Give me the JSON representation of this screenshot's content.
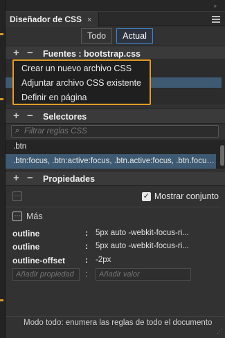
{
  "panel": {
    "title": "Diseñador de CSS",
    "close_glyph": "×"
  },
  "view_toggle": {
    "all_label": "Todo",
    "current_label": "Actual"
  },
  "sources": {
    "title": "Fuentes : bootstrap.css",
    "add_glyph": "+",
    "remove_glyph": "−"
  },
  "source_menu": {
    "items": [
      "Crear un nuevo archivo CSS",
      "Adjuntar archivo CSS existente",
      "Definir en página"
    ]
  },
  "selectors": {
    "title": "Selectores",
    "filter_placeholder": "Filtrar reglas CSS",
    "items": [
      ".btn",
      ".btn:focus, .btn:active:focus, .btn.active:focus, .btn.focus..."
    ],
    "selected_index": 1
  },
  "properties": {
    "title": "Propiedades",
    "show_set_label": "Mostrar conjunto",
    "show_set_checked": true,
    "more_label": "Más",
    "rows": [
      {
        "name": "outline",
        "value": "5px auto -webkit-focus-ri..."
      },
      {
        "name": "outline",
        "value": "5px auto -webkit-focus-ri..."
      },
      {
        "name": "outline-offset",
        "value": "-2px"
      }
    ],
    "add_property_placeholder": "Añadir propiedad",
    "add_value_placeholder": "Añadir valor"
  },
  "footer": {
    "text": "Modo todo: enumera las reglas de todo el documento"
  },
  "colors": {
    "accent": "#3f88d1",
    "highlight_border": "#e39c24",
    "selection": "#3e5a72"
  },
  "icons": [
    "panel-menu-icon",
    "search-icon",
    "checkbox-checked-icon",
    "more-expand-icon",
    "resize-grip-icon"
  ]
}
